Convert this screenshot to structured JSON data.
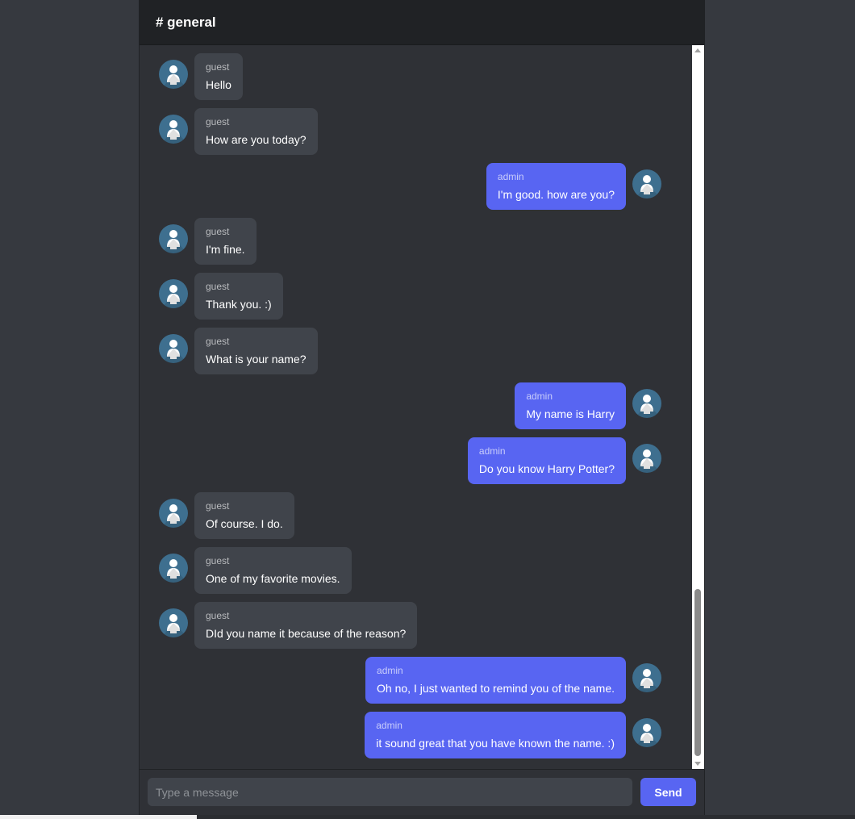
{
  "channel": {
    "title": "# general"
  },
  "messages": [
    {
      "author": "guest",
      "text": "Hello",
      "side": "left"
    },
    {
      "author": "guest",
      "text": "How are you today?",
      "side": "left"
    },
    {
      "author": "admin",
      "text": "I'm good. how are you?",
      "side": "right"
    },
    {
      "author": "guest",
      "text": "I'm fine.",
      "side": "left"
    },
    {
      "author": "guest",
      "text": "Thank you. :)",
      "side": "left"
    },
    {
      "author": "guest",
      "text": "What is your name?",
      "side": "left"
    },
    {
      "author": "admin",
      "text": "My name is Harry",
      "side": "right"
    },
    {
      "author": "admin",
      "text": "Do you know Harry Potter?",
      "side": "right"
    },
    {
      "author": "guest",
      "text": "Of course. I do.",
      "side": "left"
    },
    {
      "author": "guest",
      "text": "One of my favorite movies.",
      "side": "left"
    },
    {
      "author": "guest",
      "text": "DId you name it because of the reason?",
      "side": "left"
    },
    {
      "author": "admin",
      "text": "Oh no, I just wanted to remind you of the name.",
      "side": "right"
    },
    {
      "author": "admin",
      "text": "it sound great that you have known the name. :)",
      "side": "right"
    }
  ],
  "composer": {
    "placeholder": "Type a message",
    "value": "",
    "send_label": "Send"
  },
  "icons": {
    "avatar": "user-avatar-icon"
  },
  "colors": {
    "background": "#36393f",
    "panel": "#2f3136",
    "header": "#202225",
    "guest_bubble": "#40444b",
    "admin_bubble": "#5865f2",
    "avatar": "#3e6f8f"
  }
}
